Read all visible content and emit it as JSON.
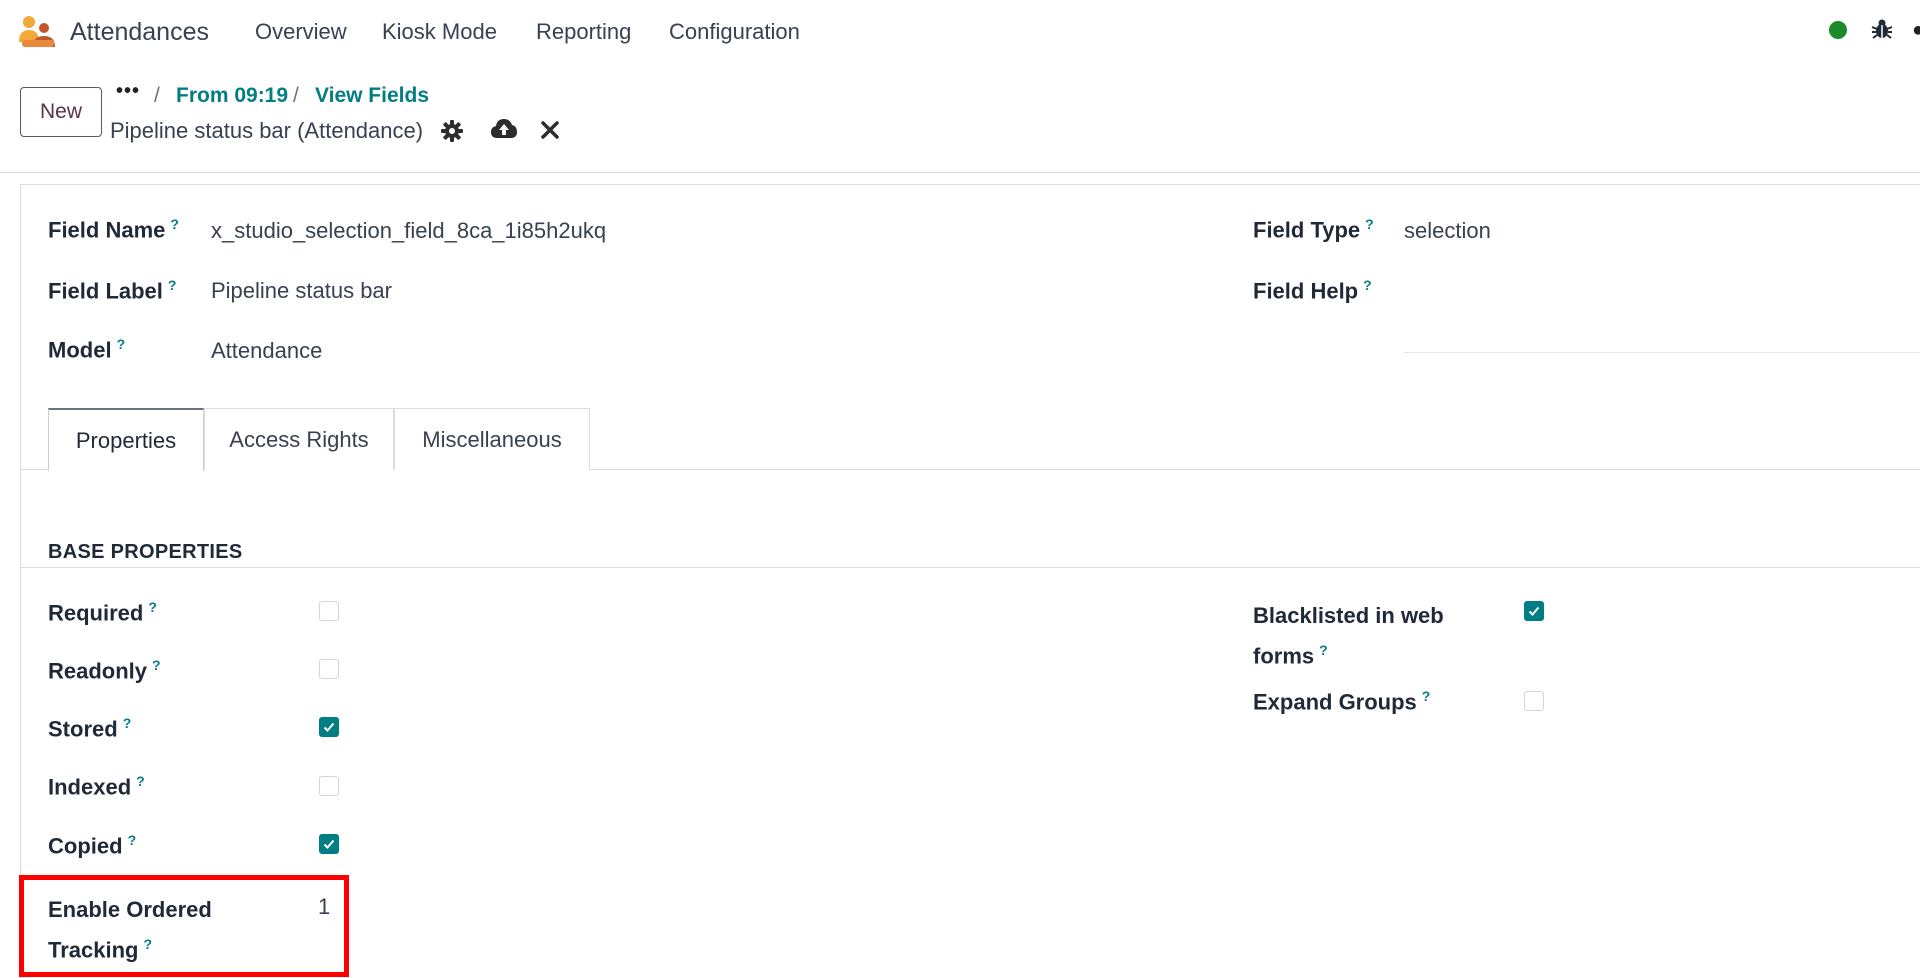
{
  "app": {
    "name": "Attendances",
    "logo_icon": "attendances-app-icon"
  },
  "menu": [
    "Overview",
    "Kiosk Mode",
    "Reporting",
    "Configuration"
  ],
  "systray": {
    "status_color": "#1e8a2a",
    "bug_icon": "bug-icon"
  },
  "control_panel": {
    "new_label": "New",
    "breadcrumb_more": "•••",
    "breadcrumb": [
      "From 09:19",
      "View Fields"
    ],
    "separator": "/",
    "record_title": "Pipeline status bar (Attendance)",
    "icons": [
      "gear-icon",
      "cloud-upload-icon",
      "close-icon"
    ]
  },
  "form": {
    "help_mark": "?",
    "field_name": {
      "label": "Field Name",
      "value": "x_studio_selection_field_8ca_1i85h2ukq"
    },
    "field_label": {
      "label": "Field Label",
      "value": "Pipeline status bar"
    },
    "model": {
      "label": "Model",
      "value": "Attendance"
    },
    "field_type": {
      "label": "Field Type",
      "value": "selection"
    },
    "field_help": {
      "label": "Field Help",
      "value": ""
    }
  },
  "tabs": [
    "Properties",
    "Access Rights",
    "Miscellaneous"
  ],
  "active_tab": "Properties",
  "section": {
    "title": "BASE PROPERTIES"
  },
  "properties": {
    "required": {
      "label": "Required",
      "checked": false
    },
    "readonly": {
      "label": "Readonly",
      "checked": false
    },
    "stored": {
      "label": "Stored",
      "checked": true
    },
    "indexed": {
      "label": "Indexed",
      "checked": false
    },
    "copied": {
      "label": "Copied",
      "checked": true
    },
    "ordered_tracking": {
      "label_line1": "Enable Ordered",
      "label_line2": "Tracking",
      "value": "1"
    },
    "blacklisted": {
      "label_line1": "Blacklisted in web",
      "label_line2": "forms",
      "checked": true
    },
    "expand_groups": {
      "label": "Expand Groups",
      "checked": false
    }
  },
  "colors": {
    "accent": "#017e84",
    "brand": "#714b67",
    "highlight": "#ff0000"
  }
}
